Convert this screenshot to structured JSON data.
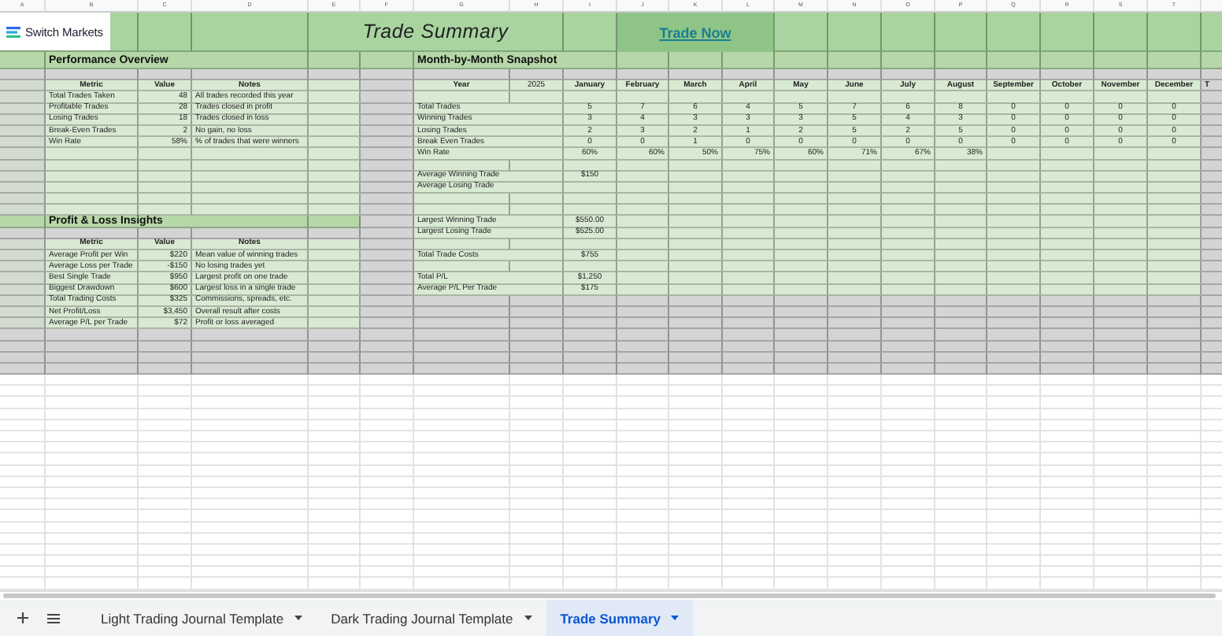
{
  "column_headers": [
    "A",
    "B",
    "C",
    "D",
    "E",
    "F",
    "G",
    "H",
    "I",
    "J",
    "K",
    "L",
    "M",
    "N",
    "O",
    "P",
    "Q",
    "R",
    "S",
    "T"
  ],
  "logo": {
    "text": "Switch Markets"
  },
  "title": "Trade Summary",
  "trade_now_link": "Trade Now",
  "performance_overview": {
    "title": "Performance Overview",
    "columns": [
      "Metric",
      "Value",
      "Notes"
    ],
    "rows": [
      [
        "Total Trades Taken",
        "48",
        "All trades recorded this year"
      ],
      [
        "Profitable Trades",
        "28",
        "Trades closed in profit"
      ],
      [
        "Losing Trades",
        "18",
        "Trades closed in loss"
      ],
      [
        "Break-Even Trades",
        "2",
        "No gain, no loss"
      ],
      [
        "Win Rate",
        "58%",
        "% of trades that were winners"
      ]
    ]
  },
  "profit_loss_insights": {
    "title": "Profit & Loss Insights",
    "columns": [
      "Metric",
      "Value",
      "Notes"
    ],
    "rows": [
      [
        "Average Profit per Win",
        "$220",
        "Mean value of winning trades"
      ],
      [
        "Average Loss per Trade",
        "-$150",
        "No losing trades yet"
      ],
      [
        "Best Single Trade",
        "$950",
        "Largest profit on one trade"
      ],
      [
        "Biggest Drawdown",
        "$600",
        "Largest loss in a single trade"
      ],
      [
        "Total Trading Costs",
        "$325",
        "Commissions, spreads, etc."
      ],
      [
        "Net Profit/Loss",
        "$3,450",
        "Overall result after costs"
      ],
      [
        "Average P/L per Trade",
        "$72",
        "Profit or loss averaged"
      ]
    ]
  },
  "monthly_snapshot": {
    "title": "Month-by-Month Snapshot",
    "year_label": "Year",
    "year": "2025",
    "months": [
      "January",
      "February",
      "March",
      "April",
      "May",
      "June",
      "July",
      "August",
      "September",
      "October",
      "November",
      "December"
    ],
    "cut_header": "T",
    "rows": [
      {
        "label": "Total Trades",
        "values": [
          "5",
          "7",
          "6",
          "4",
          "5",
          "7",
          "6",
          "8",
          "0",
          "0",
          "0",
          "0"
        ]
      },
      {
        "label": "Winning Trades",
        "values": [
          "3",
          "4",
          "3",
          "3",
          "3",
          "5",
          "4",
          "3",
          "0",
          "0",
          "0",
          "0"
        ]
      },
      {
        "label": "Losing Trades",
        "values": [
          "2",
          "3",
          "2",
          "1",
          "2",
          "5",
          "2",
          "5",
          "0",
          "0",
          "0",
          "0"
        ]
      },
      {
        "label": "Break Even Trades",
        "values": [
          "0",
          "0",
          "1",
          "0",
          "0",
          "0",
          "0",
          "0",
          "0",
          "0",
          "0",
          "0"
        ]
      },
      {
        "label": "Win Rate",
        "values": [
          "60%",
          "60%",
          "50%",
          "75%",
          "60%",
          "71%",
          "67%",
          "38%"
        ]
      }
    ],
    "summary_groups": [
      [
        {
          "label": "Average Winning Trade",
          "value": "$150"
        },
        {
          "label": "Average Losing Trade"
        }
      ],
      [
        {
          "label": "Largest Winning Trade",
          "value": "$550.00"
        },
        {
          "label": "Largest Losing Trade",
          "value": "$525.00"
        }
      ],
      [
        {
          "label": "Total Trade Costs",
          "value": "$755"
        }
      ],
      [
        {
          "label": "Total P/L",
          "value": "$1,250"
        },
        {
          "label": "Average P/L Per Trade",
          "value": "$175"
        }
      ]
    ]
  },
  "sheet_tabs": [
    {
      "label": "Light Trading Journal Template",
      "selected": false
    },
    {
      "label": "Dark Trading Journal Template",
      "selected": false
    },
    {
      "label": "Trade Summary",
      "selected": true
    }
  ]
}
